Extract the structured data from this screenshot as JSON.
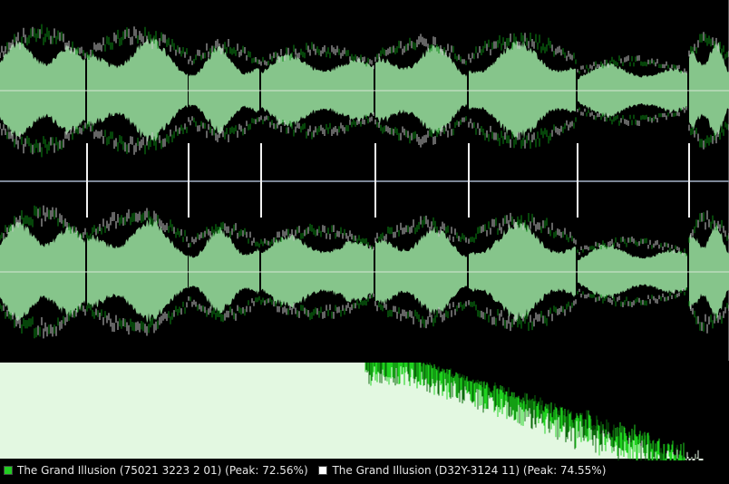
{
  "colors": {
    "background": "#000000",
    "wave_fill": "#86c58b",
    "wave_dark": "#0c8a14",
    "wave_light": "#c8c8c8",
    "spectrum_fill": "#d8f5d6",
    "spectrum_peak": "#1fd21f",
    "divider": "#7d8797",
    "track_markers": "#f2f2f2"
  },
  "legend": [
    {
      "label": "The Grand Illusion (75021 3223 2 01) (Peak: 72.56%)",
      "color": "#22cc22"
    },
    {
      "label": "The Grand Illusion (D32Y-3124 11) (Peak: 74.55%)",
      "color": "#ffffff"
    }
  ],
  "chart_data": {
    "type": "area",
    "description_series": "waveform amplitude per track segment (relative 0-1)",
    "segments": [
      {
        "start": 0.0,
        "end": 0.117,
        "amplitude": 0.62
      },
      {
        "start": 0.119,
        "end": 0.257,
        "amplitude": 0.6
      },
      {
        "start": 0.259,
        "end": 0.356,
        "amplitude": 0.48
      },
      {
        "start": 0.358,
        "end": 0.513,
        "amplitude": 0.45
      },
      {
        "start": 0.515,
        "end": 0.641,
        "amplitude": 0.52
      },
      {
        "start": 0.643,
        "end": 0.79,
        "amplitude": 0.55
      },
      {
        "start": 0.792,
        "end": 0.943,
        "amplitude": 0.33
      },
      {
        "start": 0.945,
        "end": 1.0,
        "amplitude": 0.58
      }
    ],
    "track_boundaries": [
      0.118,
      0.258,
      0.357,
      0.514,
      0.642,
      0.791,
      0.944
    ],
    "spectrum_cutoff": 0.94
  }
}
